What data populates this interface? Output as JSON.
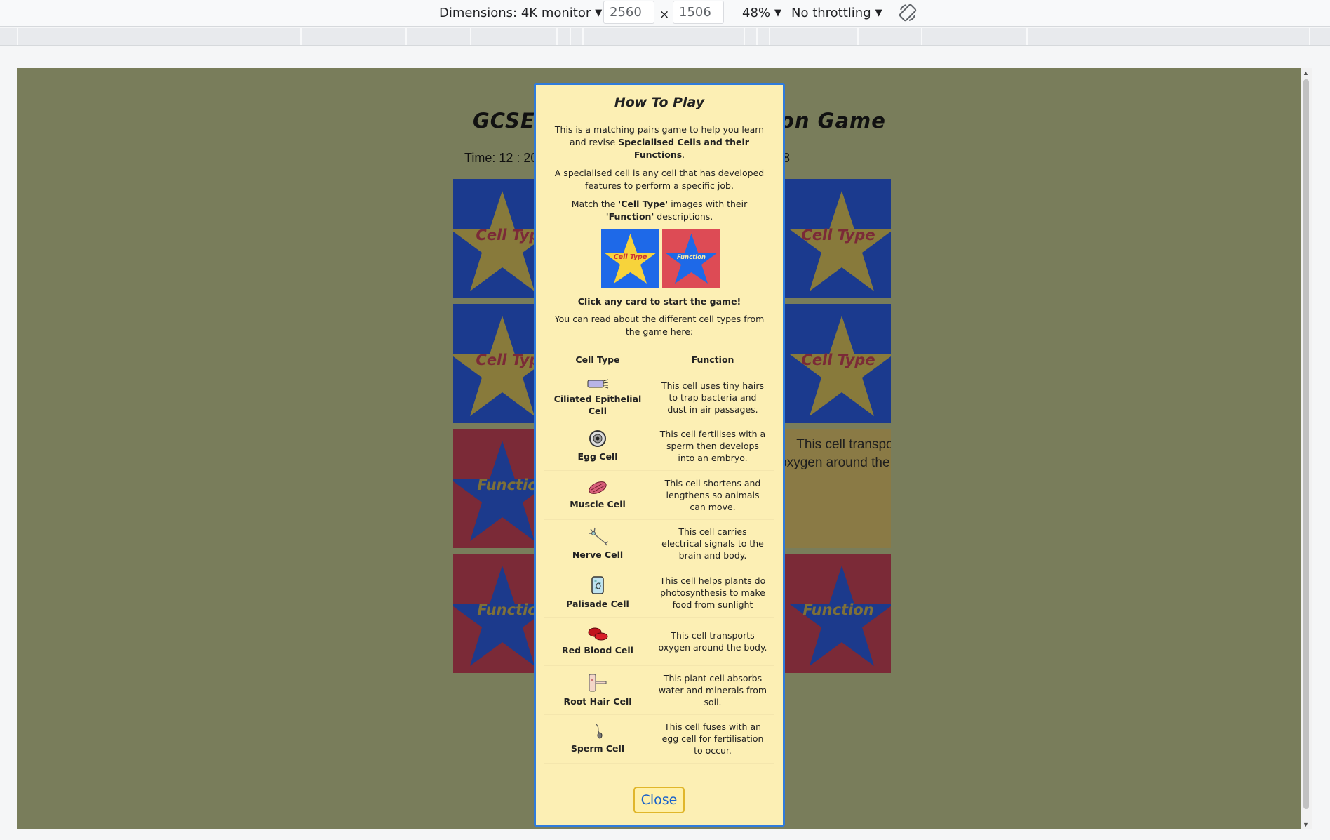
{
  "devtools": {
    "dimensions_label": "Dimensions: 4K monitor",
    "width_value": "2560",
    "times_symbol": "×",
    "height_value": "1506",
    "zoom": "48%",
    "throttling": "No throttling"
  },
  "game": {
    "title_left": "GCSE",
    "title_right": "on Game",
    "timer_label": "Time: 12 : 20",
    "moves_fragment": "8",
    "card_celltype_label": "Cell Type",
    "card_function_label": "Function",
    "revealed_card_text": "This cell transports oxygen around the body."
  },
  "modal": {
    "title": "How To Play",
    "intro_pre": "This is a matching pairs game to help you learn and revise ",
    "intro_bold": "Specialised Cells and their Functions",
    "intro_post": ".",
    "definition": "A specialised cell is any cell that has developed features to perform a specific job.",
    "match_pre": "Match the ",
    "match_bold1": "'Cell Type'",
    "match_mid": " images with their ",
    "match_bold2": "'Function'",
    "match_post": " descriptions.",
    "demo_celltype": "Cell Type",
    "demo_function": "Function",
    "start_hint": "Click any card to start the game!",
    "read_more": "You can read about the different cell types from the game here:",
    "table": {
      "headers": [
        "Cell Type",
        "Function"
      ],
      "rows": [
        {
          "cell": "Ciliated Epithelial Cell",
          "function": "This cell uses tiny hairs to trap bacteria and dust in air passages.",
          "icon": "ciliated-cell-icon"
        },
        {
          "cell": "Egg Cell",
          "function": "This cell fertilises with a sperm then develops into an embryo.",
          "icon": "egg-cell-icon"
        },
        {
          "cell": "Muscle Cell",
          "function": "This cell shortens and lengthens so animals can move.",
          "icon": "muscle-cell-icon"
        },
        {
          "cell": "Nerve Cell",
          "function": "This cell carries electrical signals to the brain and body.",
          "icon": "nerve-cell-icon"
        },
        {
          "cell": "Palisade Cell",
          "function": "This cell helps plants do photosynthesis to make food from sunlight",
          "icon": "palisade-cell-icon"
        },
        {
          "cell": "Red Blood Cell",
          "function": "This cell transports oxygen around the body.",
          "icon": "red-blood-cell-icon"
        },
        {
          "cell": "Root Hair Cell",
          "function": "This plant cell absorbs water and minerals from soil.",
          "icon": "root-hair-cell-icon"
        },
        {
          "cell": "Sperm Cell",
          "function": "This cell fuses with an egg cell for fertilisation to occur.",
          "icon": "sperm-cell-icon"
        }
      ]
    },
    "close_label": "Close"
  }
}
